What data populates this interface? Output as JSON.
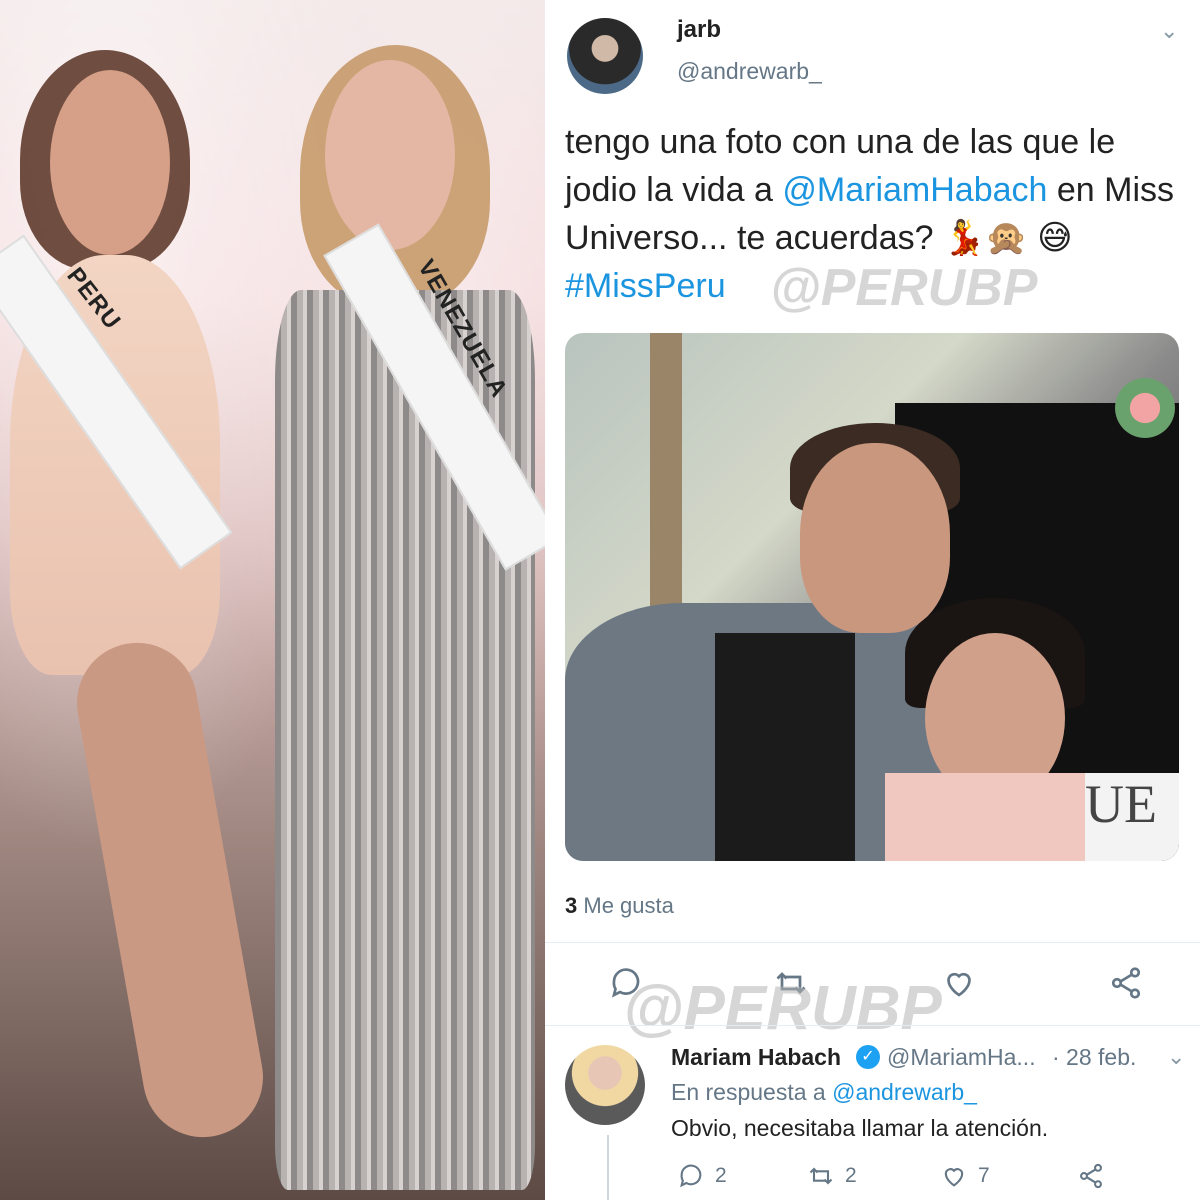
{
  "left_image": {
    "sash_left": "PERU",
    "sash_right": "VENEZUELA"
  },
  "tweet": {
    "author": {
      "name": "jarb",
      "handle": "@andrewarb_"
    },
    "text_parts": [
      "tengo una foto con una de las que le jodio la vida a ",
      "@MariamHabach",
      " en Miss Universo... te acuerdas? 💃🙊 😅 ",
      "#MissPeru"
    ],
    "watermark": "@PERUBP",
    "photo_sign": "UE",
    "likes": {
      "count": "3",
      "label": "Me gusta"
    },
    "actions": [
      "reply-icon",
      "retweet-icon",
      "like-icon",
      "share-icon"
    ]
  },
  "reply": {
    "name": "Mariam Habach",
    "verified": true,
    "handle": "@MariamHa...",
    "date": "· 28 feb.",
    "in_reply_to_label": "En respuesta a ",
    "in_reply_to_handle": "@andrewarb_",
    "text": "Obvio, necesitaba llamar la atención.",
    "counts": {
      "replies": "2",
      "retweets": "2",
      "likes": "7"
    }
  },
  "colors": {
    "link": "#1b95e0",
    "muted": "#657786",
    "divider": "#e6ecf0",
    "verified": "#1da1f2"
  }
}
